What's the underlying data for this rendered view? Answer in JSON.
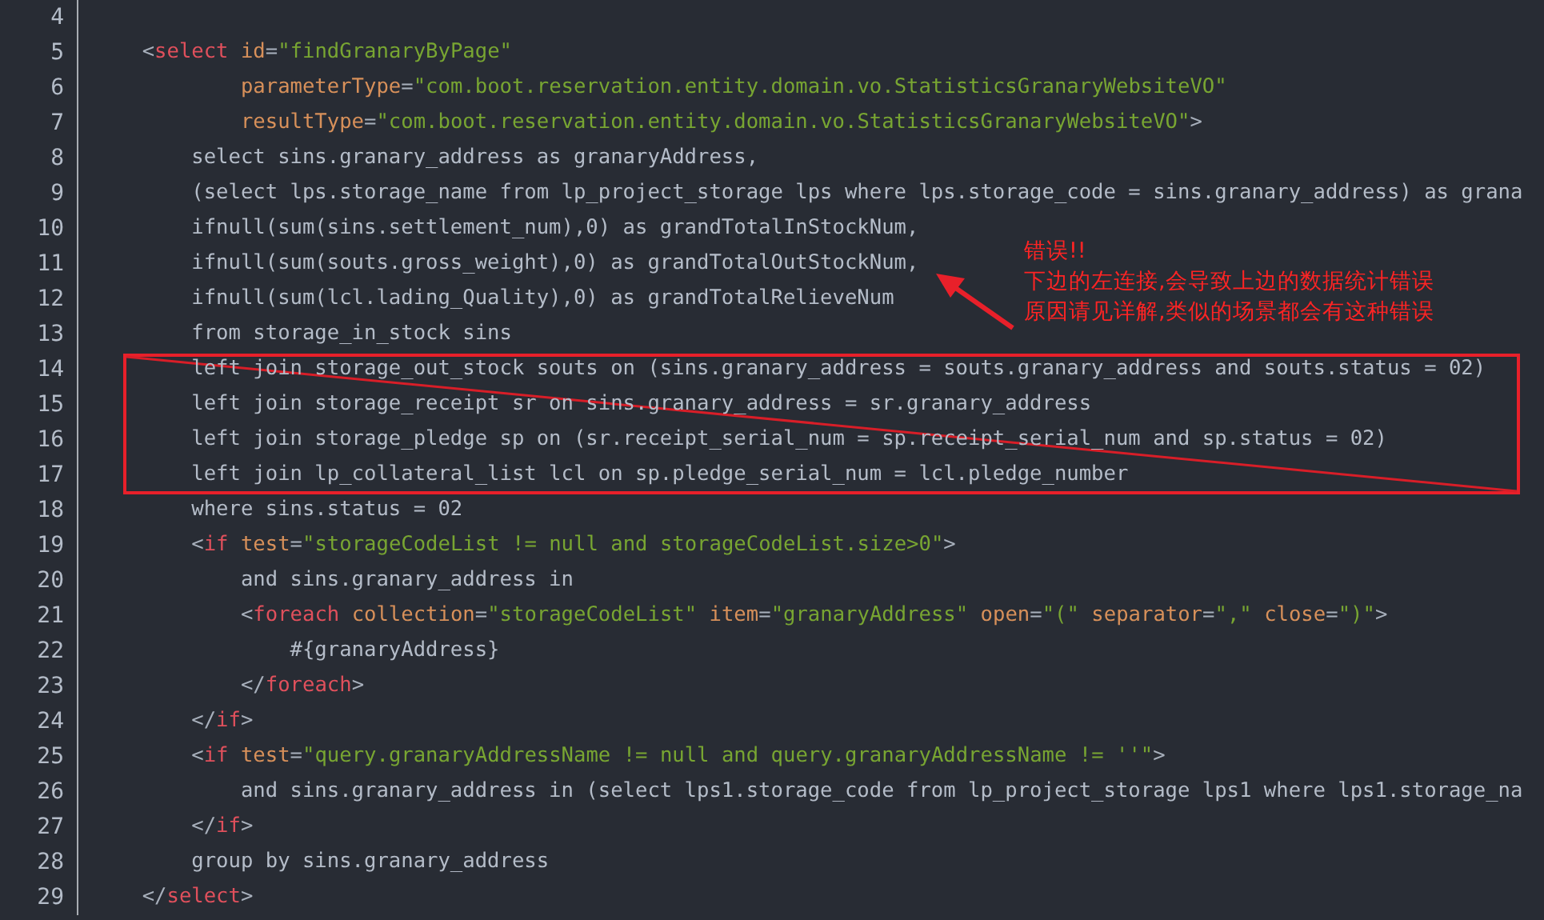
{
  "blocks": [
    {
      "boxed": false,
      "lines": [
        {
          "number": "4"
        },
        {
          "number": "5",
          "tokens": [
            {
              "kind": "punct",
              "text": "    <"
            },
            {
              "kind": "tag",
              "text": "select"
            },
            {
              "kind": "attr",
              "text": " id"
            },
            {
              "kind": "punct",
              "text": "="
            },
            {
              "kind": "string",
              "text": "\"findGranaryByPage\""
            }
          ]
        },
        {
          "number": "6",
          "tokens": [
            {
              "kind": "attr",
              "text": "            parameterType"
            },
            {
              "kind": "punct",
              "text": "="
            },
            {
              "kind": "string",
              "text": "\"com.boot.reservation.entity.domain.vo.StatisticsGranaryWebsiteVO\""
            }
          ]
        },
        {
          "number": "7",
          "tokens": [
            {
              "kind": "attr",
              "text": "            resultType"
            },
            {
              "kind": "punct",
              "text": "="
            },
            {
              "kind": "string",
              "text": "\"com.boot.reservation.entity.domain.vo.StatisticsGranaryWebsiteVO\""
            },
            {
              "kind": "punct",
              "text": ">"
            }
          ]
        },
        {
          "number": "8",
          "tokens": [
            {
              "kind": "text",
              "text": "        select sins.granary_address as granaryAddress,"
            }
          ]
        },
        {
          "number": "9",
          "tokens": [
            {
              "kind": "text",
              "text": "        (select lps.storage_name from lp_project_storage lps where lps.storage_code = sins.granary_address) as grana"
            }
          ]
        },
        {
          "number": "10",
          "tokens": [
            {
              "kind": "text",
              "text": "        ifnull(sum(sins.settlement_num),0) as grandTotalInStockNum,"
            }
          ]
        },
        {
          "number": "11",
          "tokens": [
            {
              "kind": "text",
              "text": "        ifnull(sum(souts.gross_weight),0) as grandTotalOutStockNum,"
            }
          ]
        },
        {
          "number": "12",
          "tokens": [
            {
              "kind": "text",
              "text": "        ifnull(sum(lcl.lading_Quality),0) as grandTotalRelieveNum"
            }
          ]
        },
        {
          "number": "13",
          "tokens": [
            {
              "kind": "text",
              "text": "        from storage_in_stock sins"
            }
          ]
        }
      ]
    },
    {
      "boxed": true,
      "lines": [
        {
          "number": "14",
          "tokens": [
            {
              "kind": "text",
              "text": "        left join storage_out_stock souts on (sins.granary_address = souts.granary_address and souts.status = 02)"
            }
          ]
        },
        {
          "number": "15",
          "tokens": [
            {
              "kind": "text",
              "text": "        left join storage_receipt sr on sins.granary_address = sr.granary_address"
            }
          ]
        },
        {
          "number": "16",
          "tokens": [
            {
              "kind": "text",
              "text": "        left join storage_pledge sp on (sr.receipt_serial_num = sp.receipt_serial_num and sp.status = 02)"
            }
          ]
        },
        {
          "number": "17",
          "tokens": [
            {
              "kind": "text",
              "text": "        left join lp_collateral_list lcl on sp.pledge_serial_num = lcl.pledge_number"
            }
          ]
        }
      ]
    },
    {
      "boxed": false,
      "lines": [
        {
          "number": "18",
          "tokens": [
            {
              "kind": "text",
              "text": "        where sins.status = 02"
            }
          ]
        },
        {
          "number": "19",
          "tokens": [
            {
              "kind": "punct",
              "text": "        <"
            },
            {
              "kind": "tag",
              "text": "if"
            },
            {
              "kind": "attr",
              "text": " test"
            },
            {
              "kind": "punct",
              "text": "="
            },
            {
              "kind": "string",
              "text": "\"storageCodeList != null and storageCodeList.size>0\""
            },
            {
              "kind": "punct",
              "text": ">"
            }
          ]
        },
        {
          "number": "20",
          "tokens": [
            {
              "kind": "text",
              "text": "            and sins.granary_address in"
            }
          ]
        },
        {
          "number": "21",
          "tokens": [
            {
              "kind": "punct",
              "text": "            <"
            },
            {
              "kind": "tag",
              "text": "foreach"
            },
            {
              "kind": "attr",
              "text": " collection"
            },
            {
              "kind": "punct",
              "text": "="
            },
            {
              "kind": "string",
              "text": "\"storageCodeList\""
            },
            {
              "kind": "attr",
              "text": " item"
            },
            {
              "kind": "punct",
              "text": "="
            },
            {
              "kind": "string",
              "text": "\"granaryAddress\""
            },
            {
              "kind": "attr",
              "text": " open"
            },
            {
              "kind": "punct",
              "text": "="
            },
            {
              "kind": "string",
              "text": "\"(\""
            },
            {
              "kind": "attr",
              "text": " separator"
            },
            {
              "kind": "punct",
              "text": "="
            },
            {
              "kind": "string",
              "text": "\",\""
            },
            {
              "kind": "attr",
              "text": " close"
            },
            {
              "kind": "punct",
              "text": "="
            },
            {
              "kind": "string",
              "text": "\")\""
            },
            {
              "kind": "punct",
              "text": ">"
            }
          ]
        },
        {
          "number": "22",
          "tokens": [
            {
              "kind": "text",
              "text": "                #{granaryAddress}"
            }
          ]
        },
        {
          "number": "23",
          "tokens": [
            {
              "kind": "punct",
              "text": "            </"
            },
            {
              "kind": "tag",
              "text": "foreach"
            },
            {
              "kind": "punct",
              "text": ">"
            }
          ]
        },
        {
          "number": "24",
          "tokens": [
            {
              "kind": "punct",
              "text": "        </"
            },
            {
              "kind": "tag",
              "text": "if"
            },
            {
              "kind": "punct",
              "text": ">"
            }
          ]
        },
        {
          "number": "25",
          "tokens": [
            {
              "kind": "punct",
              "text": "        <"
            },
            {
              "kind": "tag",
              "text": "if"
            },
            {
              "kind": "attr",
              "text": " test"
            },
            {
              "kind": "punct",
              "text": "="
            },
            {
              "kind": "string",
              "text": "\"query.granaryAddressName != null and query.granaryAddressName != ''\""
            },
            {
              "kind": "punct",
              "text": ">"
            }
          ]
        },
        {
          "number": "26",
          "tokens": [
            {
              "kind": "text",
              "text": "            and sins.granary_address in (select lps1.storage_code from lp_project_storage lps1 where lps1.storage_na"
            }
          ]
        },
        {
          "number": "27",
          "tokens": [
            {
              "kind": "punct",
              "text": "        </"
            },
            {
              "kind": "tag",
              "text": "if"
            },
            {
              "kind": "punct",
              "text": ">"
            }
          ]
        },
        {
          "number": "28",
          "tokens": [
            {
              "kind": "text",
              "text": "        group by sins.granary_address"
            }
          ]
        },
        {
          "number": "29",
          "tokens": [
            {
              "kind": "punct",
              "text": "    </"
            },
            {
              "kind": "tag",
              "text": "select"
            },
            {
              "kind": "punct",
              "text": ">"
            }
          ]
        }
      ]
    }
  ],
  "annotation": {
    "notes": [
      "错误!!",
      "下边的左连接,会导致上边的数据统计错误",
      "原因请见详解,类似的场景都会有这种错误"
    ]
  }
}
